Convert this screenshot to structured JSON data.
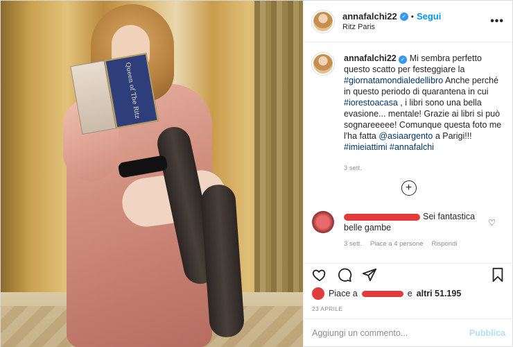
{
  "post": {
    "username": "annafalchi22",
    "follow_label": "Segui",
    "separator": "•",
    "location": "Ritz Paris",
    "more_label": "•••",
    "book_title": "Queen of The Ritz"
  },
  "caption": {
    "username": "annafalchi22",
    "text_1": "Mi sembra perfetto questo scatto per festeggiare la ",
    "tag_1": "#giornatamondialedellibro",
    "text_2": " Anche perché in questo periodo di quarantena in cui ",
    "tag_2": "#iorestoacasa",
    "text_3": " , i libri sono una bella evasione... mentale! Grazie ai libri si può sognareeeee! Comunque questa foto me l'ha fatta ",
    "tag_3": "@asiaargento",
    "text_4": " a Parigi!!! ",
    "tag_4": "#imieiattimi",
    "text_5": " ",
    "tag_5": "#annafalchi",
    "time": "3 sett."
  },
  "load_more_label": "+",
  "comment": {
    "text": "Sei fantastica belle gambe",
    "time": "3 sett.",
    "likes": "Piace a 4 persone",
    "reply": "Rispondi"
  },
  "likes": {
    "prefix": "Piace a",
    "middle": "e",
    "count": "altri 51.195"
  },
  "date": "23 APRILE",
  "add_comment": {
    "placeholder": "Aggiungi un commento...",
    "publish_label": "Pubblica"
  },
  "colors": {
    "accent": "#0095f6",
    "publish_disabled": "#b2dffc",
    "tag": "#00376b",
    "muted": "#8e8e8e"
  }
}
